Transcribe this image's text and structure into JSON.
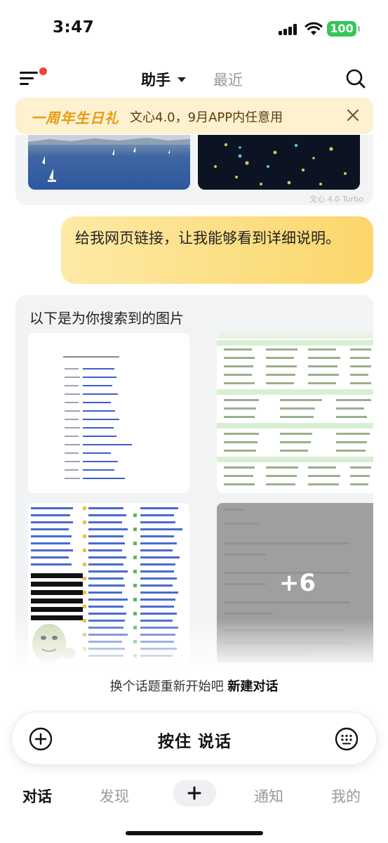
{
  "status_bar": {
    "time": "3:47",
    "battery": "100"
  },
  "top_nav": {
    "active_tab": "助手",
    "recent_tab": "最近"
  },
  "promo": {
    "tag": "一周年生日礼",
    "text": "文心4.0，9月APP内任意用"
  },
  "previous_reply": {
    "model_tag": "文心 4.0 Turbo"
  },
  "user_message": "给我网页链接，让我能够看到详细说明。",
  "reply": {
    "title": "以下是为你搜索到的图片",
    "more_count": "+6"
  },
  "restart": {
    "prefix": "换个话题重新开始吧",
    "link": "新建对话"
  },
  "input_bar": {
    "talk_label": "按住 说话"
  },
  "tabs": [
    {
      "label": "对话"
    },
    {
      "label": "发现"
    },
    {
      "label": "通知"
    },
    {
      "label": "我的"
    }
  ],
  "colors": {
    "accent_yellow": "#fcd66a",
    "promo_bg": "#fdf1cf",
    "promo_tag": "#e69a12",
    "battery": "#34c759",
    "notify_dot": "#f04438"
  }
}
